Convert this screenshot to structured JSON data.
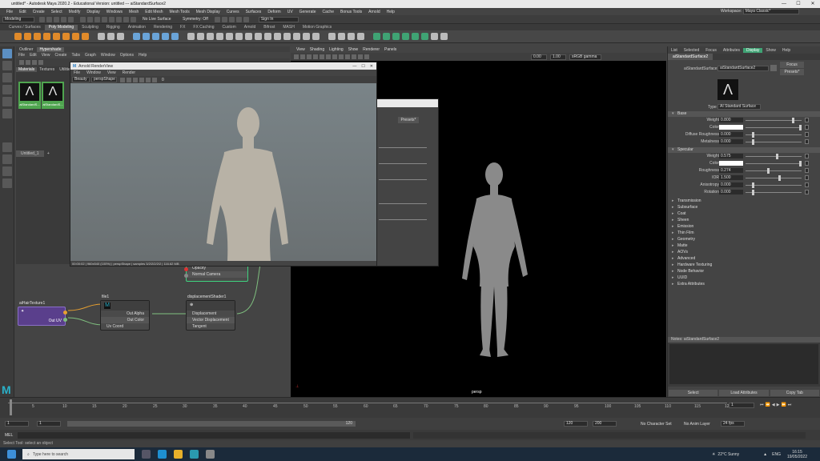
{
  "window": {
    "title": "untitled* - Autodesk Maya 2020.2 - Educational Version: untitled   ---   aiStandardSurface2"
  },
  "menubar": [
    "File",
    "Edit",
    "Create",
    "Select",
    "Modify",
    "Display",
    "Windows",
    "Mesh",
    "Edit Mesh",
    "Mesh Tools",
    "Mesh Display",
    "Curves",
    "Surfaces",
    "Deform",
    "UV",
    "Generate",
    "Cache",
    "Bonus Tools",
    "Arnold",
    "Help"
  ],
  "workspace": {
    "label": "Workspace:",
    "value": "Maya Classic*"
  },
  "statusline": {
    "mode": "Modeling",
    "live": "No Live Surface",
    "symmetry": "Symmetry: Off",
    "signin": "Sign In"
  },
  "shelf_tabs": [
    "Curves / Surfaces",
    "Poly Modeling",
    "Sculpting",
    "Rigging",
    "Animation",
    "Rendering",
    "FX",
    "FX Caching",
    "Custom",
    "Arnold",
    "Bifrost",
    "MASH",
    "Motion Graphics"
  ],
  "shelf_active": "Poly Modeling",
  "hypershade": {
    "tabs": [
      "Outliner",
      "Hypershade"
    ],
    "menu": [
      "File",
      "Edit",
      "View",
      "Create",
      "Tabs",
      "Graph",
      "Window",
      "Options",
      "Help"
    ],
    "browser_tabs": [
      "Materials",
      "Textures",
      "Utilities"
    ],
    "swatches": [
      "aiStandardS...",
      "aiStandardS..."
    ],
    "graph_tab": "Untitled_1"
  },
  "nodes": {
    "texture": {
      "title": "aiHairTexture1",
      "out": "Out UV"
    },
    "file": {
      "title": "file1",
      "attrs": [
        "Out Alpha",
        "Out Color",
        "Uv Coord"
      ]
    },
    "disp": {
      "title": "displacementShader1",
      "attrs": [
        "Displacement",
        "Vector Displacement",
        "Tangent"
      ]
    },
    "shading": {
      "attrs": [
        "Opacity",
        "Normal Camera"
      ]
    }
  },
  "renderview": {
    "title": "Arnold RenderView",
    "menu": [
      "File",
      "Window",
      "View",
      "Render"
    ],
    "dropdowns": [
      "Beauty",
      "perspShape"
    ],
    "zoom": "0",
    "status": "00:00:02 | 960x540 (100%) | perspShape | samples 3/2/2/2/2/2 | 116.62 MB"
  },
  "floatwin": {
    "preset": "Presets*"
  },
  "viewport": {
    "menu": [
      "View",
      "Shading",
      "Lighting",
      "Show",
      "Renderer",
      "Panels"
    ],
    "camera": "persp",
    "field1": "0.00",
    "field2": "1.00",
    "colorspace": "sRGB gamma"
  },
  "attr_editor": {
    "tabs": [
      "List",
      "Selected",
      "Focus",
      "Attributes",
      "Display",
      "Show",
      "Help"
    ],
    "node_tab": "aiStandardSurface2",
    "node_label": "aiStandardSurface:",
    "node_name": "aiStandardSurface2",
    "focus_btn": "Focus",
    "presets_btn": "Presets*",
    "type_label": "Type",
    "type_value": "AI Standard Surface",
    "base": {
      "title": "Base",
      "rows": [
        {
          "label": "Weight",
          "value": "0.800"
        },
        {
          "label": "Color",
          "value": ""
        },
        {
          "label": "Diffuse Roughness",
          "value": "0.000"
        },
        {
          "label": "Metalness",
          "value": "0.000"
        }
      ]
    },
    "specular": {
      "title": "Specular",
      "rows": [
        {
          "label": "Weight",
          "value": "0.575"
        },
        {
          "label": "Color",
          "value": ""
        },
        {
          "label": "Roughness",
          "value": "0.274"
        },
        {
          "label": "IOR",
          "value": "1.500"
        },
        {
          "label": "Anisotropy",
          "value": "0.000"
        },
        {
          "label": "Rotation",
          "value": "0.000"
        }
      ]
    },
    "sections": [
      "Transmission",
      "Subsurface",
      "Coat",
      "Sheen",
      "Emission",
      "Thin Film",
      "Geometry",
      "Matte",
      "AOVs",
      "Advanced",
      "Hardware Texturing",
      "Node Behavior",
      "UUID",
      "Extra Attributes"
    ],
    "notes": "Notes: aiStandardSurface2",
    "buttons": [
      "Select",
      "Load Attributes",
      "Copy Tab"
    ]
  },
  "timeline": {
    "start": "1",
    "end": "120",
    "current": "1",
    "ticks": [
      "5",
      "10",
      "15",
      "20",
      "25",
      "30",
      "35",
      "40",
      "45",
      "50",
      "55",
      "60",
      "65",
      "70",
      "75",
      "80",
      "85",
      "90",
      "95",
      "100",
      "105",
      "110",
      "115",
      "120"
    ],
    "range_start": "1",
    "range_inner": "1",
    "range_end_inner": "120",
    "range_end": "120",
    "range_max": "200",
    "no_character": "No Character Set",
    "no_anim": "No Anim Layer",
    "fps": "24 fps"
  },
  "cmdline": {
    "label": "MEL"
  },
  "helpline": "Select Tool: select an object",
  "taskbar": {
    "search": "Type here to search",
    "weather": "22°C  Sunny",
    "lang": "ENG",
    "time": "16:15",
    "date": "19/05/2022"
  }
}
